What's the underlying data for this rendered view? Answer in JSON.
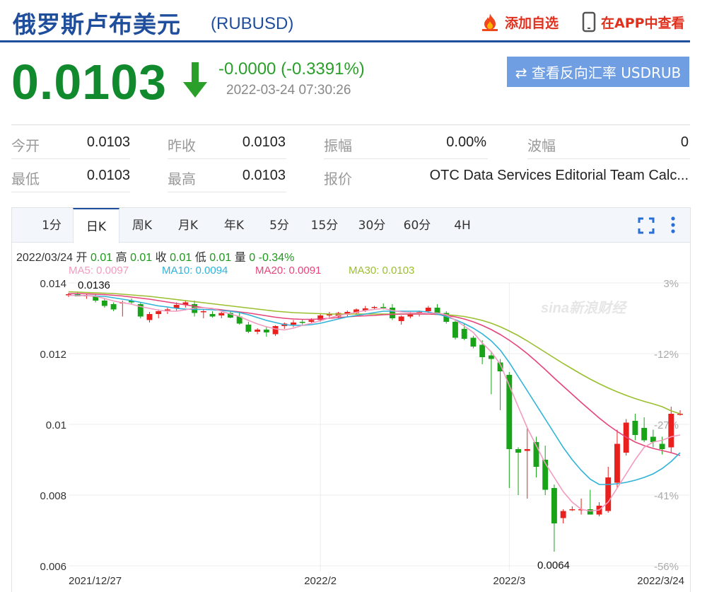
{
  "header": {
    "title": "俄罗斯卢布美元",
    "code": "(RUBUSD)",
    "add_favorite": "添加自选",
    "view_in_app": "在APP中查看"
  },
  "quote": {
    "price": "0.0103",
    "change": "-0.0000 (-0.3391%)",
    "time": "2022-03-24 07:30:26",
    "reverse_button": "⇄ 查看反向汇率 USDRUB"
  },
  "stats": {
    "row1": [
      {
        "label": "今开",
        "value": "0.0103"
      },
      {
        "label": "昨收",
        "value": "0.0103"
      },
      {
        "label": "振幅",
        "value": "0.00%"
      },
      {
        "label": "波幅",
        "value": "0"
      }
    ],
    "row2": [
      {
        "label": "最低",
        "value": "0.0103"
      },
      {
        "label": "最高",
        "value": "0.0103"
      },
      {
        "label": "报价",
        "value": "OTC Data Services Editorial Team Calc..."
      }
    ]
  },
  "tabs": [
    "1分",
    "日K",
    "周K",
    "月K",
    "年K",
    "5分",
    "15分",
    "30分",
    "60分",
    "4H"
  ],
  "active_tab": "日K",
  "info": {
    "date": "2022/03/24",
    "open_label": "开",
    "open": "0.01",
    "high_label": "高",
    "high": "0.01",
    "close_label": "收",
    "close": "0.01",
    "low_label": "低",
    "low": "0.01",
    "vol_label": "量",
    "vol": "0",
    "pct": "-0.34%"
  },
  "ma_legend": [
    {
      "label": "MA5: 0.0097",
      "color": "#f39bbf"
    },
    {
      "label": "MA10: 0.0094",
      "color": "#2fb3d8"
    },
    {
      "label": "MA20: 0.0091",
      "color": "#e5457a"
    },
    {
      "label": "MA30: 0.0103",
      "color": "#9bbf2f"
    }
  ],
  "colors": {
    "up": "#e8201e",
    "down": "#19a319",
    "brand": "#1f4e9c",
    "accent_red": "#e0301e"
  },
  "chart_data": {
    "type": "candlestick",
    "y_ticks": [
      "0.014",
      "0.012",
      "0.01",
      "0.008",
      "0.006"
    ],
    "y_tick_values": [
      0.014,
      0.012,
      0.01,
      0.008,
      0.006
    ],
    "ylim": [
      0.006,
      0.014
    ],
    "pct_ticks": [
      "3%",
      "-12%",
      "-27%",
      "-41%",
      "-56%"
    ],
    "x_ticks": [
      "2021/12/27",
      "2022/2",
      "2022/3",
      "2022/3/24"
    ],
    "x_tick_indices": [
      0,
      28,
      49,
      68
    ],
    "max_label": "0.0136",
    "min_label": "0.0064",
    "watermark": "sina新浪财经",
    "candles": [
      {
        "o": 0.01365,
        "h": 0.01372,
        "l": 0.0136,
        "c": 0.01368
      },
      {
        "o": 0.01368,
        "h": 0.01375,
        "l": 0.01362,
        "c": 0.01362
      },
      {
        "o": 0.01362,
        "h": 0.0137,
        "l": 0.01355,
        "c": 0.01365
      },
      {
        "o": 0.01362,
        "h": 0.01368,
        "l": 0.01345,
        "c": 0.0135
      },
      {
        "o": 0.0135,
        "h": 0.01355,
        "l": 0.0133,
        "c": 0.01335
      },
      {
        "o": 0.0134,
        "h": 0.01345,
        "l": 0.0132,
        "c": 0.01325
      },
      {
        "o": 0.01345,
        "h": 0.0135,
        "l": 0.01305,
        "c": 0.01345
      },
      {
        "o": 0.0135,
        "h": 0.01356,
        "l": 0.0134,
        "c": 0.01345
      },
      {
        "o": 0.0134,
        "h": 0.01345,
        "l": 0.013,
        "c": 0.01305
      },
      {
        "o": 0.01295,
        "h": 0.01318,
        "l": 0.01288,
        "c": 0.01312
      },
      {
        "o": 0.01312,
        "h": 0.01325,
        "l": 0.013,
        "c": 0.0132
      },
      {
        "o": 0.01322,
        "h": 0.0133,
        "l": 0.01312,
        "c": 0.01325
      },
      {
        "o": 0.01328,
        "h": 0.01345,
        "l": 0.0132,
        "c": 0.01338
      },
      {
        "o": 0.01338,
        "h": 0.0135,
        "l": 0.0133,
        "c": 0.01345
      },
      {
        "o": 0.0134,
        "h": 0.0135,
        "l": 0.01305,
        "c": 0.01315
      },
      {
        "o": 0.01318,
        "h": 0.01325,
        "l": 0.013,
        "c": 0.0132
      },
      {
        "o": 0.01312,
        "h": 0.0132,
        "l": 0.01302,
        "c": 0.01305
      },
      {
        "o": 0.01308,
        "h": 0.01318,
        "l": 0.013,
        "c": 0.01315
      },
      {
        "o": 0.01315,
        "h": 0.01322,
        "l": 0.013,
        "c": 0.01302
      },
      {
        "o": 0.01305,
        "h": 0.01318,
        "l": 0.01282,
        "c": 0.01285
      },
      {
        "o": 0.01282,
        "h": 0.0129,
        "l": 0.01258,
        "c": 0.01262
      },
      {
        "o": 0.01262,
        "h": 0.01272,
        "l": 0.01255,
        "c": 0.01268
      },
      {
        "o": 0.01268,
        "h": 0.01275,
        "l": 0.01248,
        "c": 0.0126
      },
      {
        "o": 0.01255,
        "h": 0.0128,
        "l": 0.0125,
        "c": 0.01278
      },
      {
        "o": 0.01278,
        "h": 0.01288,
        "l": 0.0127,
        "c": 0.01285
      },
      {
        "o": 0.01282,
        "h": 0.01295,
        "l": 0.01275,
        "c": 0.01288
      },
      {
        "o": 0.0129,
        "h": 0.01298,
        "l": 0.01282,
        "c": 0.01288
      },
      {
        "o": 0.0129,
        "h": 0.013,
        "l": 0.01285,
        "c": 0.01295
      },
      {
        "o": 0.01295,
        "h": 0.01312,
        "l": 0.0129,
        "c": 0.01308
      },
      {
        "o": 0.01308,
        "h": 0.01318,
        "l": 0.01298,
        "c": 0.01312
      },
      {
        "o": 0.01305,
        "h": 0.01318,
        "l": 0.013,
        "c": 0.01315
      },
      {
        "o": 0.0131,
        "h": 0.01322,
        "l": 0.01305,
        "c": 0.01318
      },
      {
        "o": 0.01315,
        "h": 0.01328,
        "l": 0.0131,
        "c": 0.01325
      },
      {
        "o": 0.01322,
        "h": 0.01335,
        "l": 0.01318,
        "c": 0.01328
      },
      {
        "o": 0.0133,
        "h": 0.01335,
        "l": 0.01325,
        "c": 0.01332
      },
      {
        "o": 0.01332,
        "h": 0.01342,
        "l": 0.01325,
        "c": 0.0133
      },
      {
        "o": 0.0133,
        "h": 0.0134,
        "l": 0.01295,
        "c": 0.013
      },
      {
        "o": 0.01292,
        "h": 0.01308,
        "l": 0.01282,
        "c": 0.01305
      },
      {
        "o": 0.01305,
        "h": 0.01318,
        "l": 0.013,
        "c": 0.01312
      },
      {
        "o": 0.01312,
        "h": 0.01322,
        "l": 0.01305,
        "c": 0.01318
      },
      {
        "o": 0.0132,
        "h": 0.01335,
        "l": 0.01312,
        "c": 0.0133
      },
      {
        "o": 0.0133,
        "h": 0.0134,
        "l": 0.0131,
        "c": 0.01315
      },
      {
        "o": 0.01315,
        "h": 0.0132,
        "l": 0.01285,
        "c": 0.0129
      },
      {
        "o": 0.0129,
        "h": 0.01295,
        "l": 0.0124,
        "c": 0.01245
      },
      {
        "o": 0.0127,
        "h": 0.01285,
        "l": 0.01238,
        "c": 0.01242
      },
      {
        "o": 0.01245,
        "h": 0.0125,
        "l": 0.01215,
        "c": 0.0122
      },
      {
        "o": 0.01225,
        "h": 0.01238,
        "l": 0.0117,
        "c": 0.0119
      },
      {
        "o": 0.01195,
        "h": 0.01205,
        "l": 0.01085,
        "c": 0.01185
      },
      {
        "o": 0.01175,
        "h": 0.01185,
        "l": 0.0104,
        "c": 0.0115
      },
      {
        "o": 0.0114,
        "h": 0.01148,
        "l": 0.0082,
        "c": 0.0093
      },
      {
        "o": 0.0093,
        "h": 0.00935,
        "l": 0.008,
        "c": 0.0092
      },
      {
        "o": 0.00925,
        "h": 0.0099,
        "l": 0.0079,
        "c": 0.0093
      },
      {
        "o": 0.0095,
        "h": 0.00965,
        "l": 0.0085,
        "c": 0.0088
      },
      {
        "o": 0.009,
        "h": 0.0094,
        "l": 0.008,
        "c": 0.00815
      },
      {
        "o": 0.0082,
        "h": 0.0083,
        "l": 0.0064,
        "c": 0.0072
      },
      {
        "o": 0.00735,
        "h": 0.0076,
        "l": 0.0072,
        "c": 0.00755
      },
      {
        "o": 0.0076,
        "h": 0.00768,
        "l": 0.00755,
        "c": 0.0076
      },
      {
        "o": 0.00758,
        "h": 0.0079,
        "l": 0.00745,
        "c": 0.0076
      },
      {
        "o": 0.0076,
        "h": 0.00815,
        "l": 0.00748,
        "c": 0.00745
      },
      {
        "o": 0.00745,
        "h": 0.0078,
        "l": 0.0074,
        "c": 0.0077
      },
      {
        "o": 0.00755,
        "h": 0.0088,
        "l": 0.0075,
        "c": 0.0085
      },
      {
        "o": 0.00835,
        "h": 0.00985,
        "l": 0.0082,
        "c": 0.00945
      },
      {
        "o": 0.0092,
        "h": 0.01015,
        "l": 0.00912,
        "c": 0.01005
      },
      {
        "o": 0.0101,
        "h": 0.0103,
        "l": 0.00955,
        "c": 0.0097
      },
      {
        "o": 0.0099,
        "h": 0.0102,
        "l": 0.0095,
        "c": 0.00955
      },
      {
        "o": 0.00965,
        "h": 0.00985,
        "l": 0.00935,
        "c": 0.0095
      },
      {
        "o": 0.00945,
        "h": 0.00965,
        "l": 0.00915,
        "c": 0.0093
      },
      {
        "o": 0.00935,
        "h": 0.0105,
        "l": 0.0092,
        "c": 0.0103
      },
      {
        "o": 0.0103,
        "h": 0.0104,
        "l": 0.01025,
        "c": 0.0103
      }
    ],
    "ma5": [
      0.01365,
      0.01364,
      0.01364,
      0.01362,
      0.01356,
      0.01349,
      0.01344,
      0.0134,
      0.01333,
      0.01328,
      0.01323,
      0.0132,
      0.0132,
      0.01324,
      0.01329,
      0.0133,
      0.01328,
      0.0132,
      0.01312,
      0.01305,
      0.01294,
      0.01284,
      0.01276,
      0.0127,
      0.01267,
      0.01272,
      0.0128,
      0.01286,
      0.01293,
      0.01301,
      0.01308,
      0.01312,
      0.01317,
      0.01322,
      0.01325,
      0.01328,
      0.01322,
      0.01318,
      0.01316,
      0.01315,
      0.01314,
      0.01315,
      0.0131,
      0.01295,
      0.01278,
      0.0126,
      0.0123,
      0.01205,
      0.0117,
      0.0111,
      0.0105,
      0.0099,
      0.0094,
      0.0089,
      0.0085,
      0.0081,
      0.0078,
      0.0076,
      0.00755,
      0.00758,
      0.0078,
      0.0082,
      0.0086,
      0.009,
      0.00935,
      0.0095,
      0.00955,
      0.00965,
      0.0097
    ],
    "ma10": [
      0.01365,
      0.01365,
      0.01364,
      0.01363,
      0.01362,
      0.01358,
      0.01354,
      0.0135,
      0.01345,
      0.0134,
      0.01335,
      0.01332,
      0.01328,
      0.01326,
      0.01325,
      0.01325,
      0.01324,
      0.01322,
      0.0132,
      0.01316,
      0.0131,
      0.01302,
      0.01294,
      0.01288,
      0.01282,
      0.0128,
      0.0128,
      0.01282,
      0.01286,
      0.01292,
      0.01298,
      0.01304,
      0.01308,
      0.01312,
      0.01316,
      0.0132,
      0.0132,
      0.0132,
      0.0132,
      0.0132,
      0.01318,
      0.01312,
      0.01305,
      0.01296,
      0.01285,
      0.01272,
      0.01256,
      0.01236,
      0.0121,
      0.01175,
      0.01135,
      0.01095,
      0.01055,
      0.01015,
      0.00975,
      0.00935,
      0.009,
      0.0087,
      0.00845,
      0.0083,
      0.0083,
      0.00832,
      0.00836,
      0.00842,
      0.0085,
      0.0086,
      0.00875,
      0.00895,
      0.0092
    ],
    "ma20": [
      0.0137,
      0.0137,
      0.01369,
      0.01368,
      0.01367,
      0.01365,
      0.01363,
      0.0136,
      0.01357,
      0.01354,
      0.0135,
      0.01346,
      0.01342,
      0.01338,
      0.01334,
      0.0133,
      0.01327,
      0.01324,
      0.01321,
      0.01318,
      0.01315,
      0.01311,
      0.01307,
      0.01303,
      0.013,
      0.01298,
      0.01297,
      0.01297,
      0.01298,
      0.013,
      0.01302,
      0.01304,
      0.01306,
      0.01307,
      0.01308,
      0.0131,
      0.01311,
      0.01312,
      0.01312,
      0.01312,
      0.01312,
      0.01311,
      0.01308,
      0.01304,
      0.01298,
      0.0129,
      0.0128,
      0.01268,
      0.01254,
      0.01238,
      0.0122,
      0.012,
      0.01178,
      0.01155,
      0.01131,
      0.01108,
      0.01085,
      0.01062,
      0.0104,
      0.01018,
      0.00998,
      0.0098,
      0.00964,
      0.0095,
      0.0094,
      0.00932,
      0.00926,
      0.0092,
      0.00912
    ],
    "ma30": [
      0.01375,
      0.01374,
      0.01373,
      0.01372,
      0.01371,
      0.0137,
      0.01368,
      0.01366,
      0.01364,
      0.01362,
      0.01359,
      0.01356,
      0.01353,
      0.0135,
      0.01347,
      0.01344,
      0.01341,
      0.01338,
      0.01335,
      0.01332,
      0.01329,
      0.01326,
      0.01323,
      0.0132,
      0.01318,
      0.01316,
      0.01315,
      0.01314,
      0.01313,
      0.01312,
      0.01312,
      0.01312,
      0.01312,
      0.01312,
      0.01312,
      0.01312,
      0.01312,
      0.01312,
      0.01312,
      0.01312,
      0.01312,
      0.01311,
      0.0131,
      0.01308,
      0.01305,
      0.013,
      0.01294,
      0.01286,
      0.01276,
      0.01264,
      0.01251,
      0.01236,
      0.0122,
      0.01204,
      0.01188,
      0.01172,
      0.01157,
      0.01142,
      0.01128,
      0.01115,
      0.01103,
      0.01092,
      0.01082,
      0.01073,
      0.01065,
      0.01058,
      0.0105,
      0.01038,
      0.0103
    ]
  }
}
